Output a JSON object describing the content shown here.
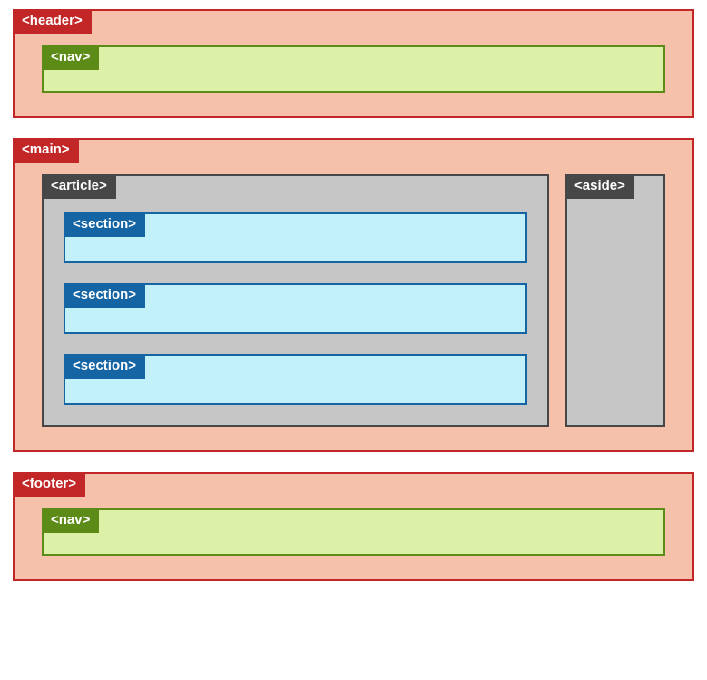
{
  "labels": {
    "header": "<header>",
    "main": "<main>",
    "footer": "<footer>",
    "nav": "<nav>",
    "article": "<article>",
    "aside": "<aside>",
    "section": "<section>"
  }
}
